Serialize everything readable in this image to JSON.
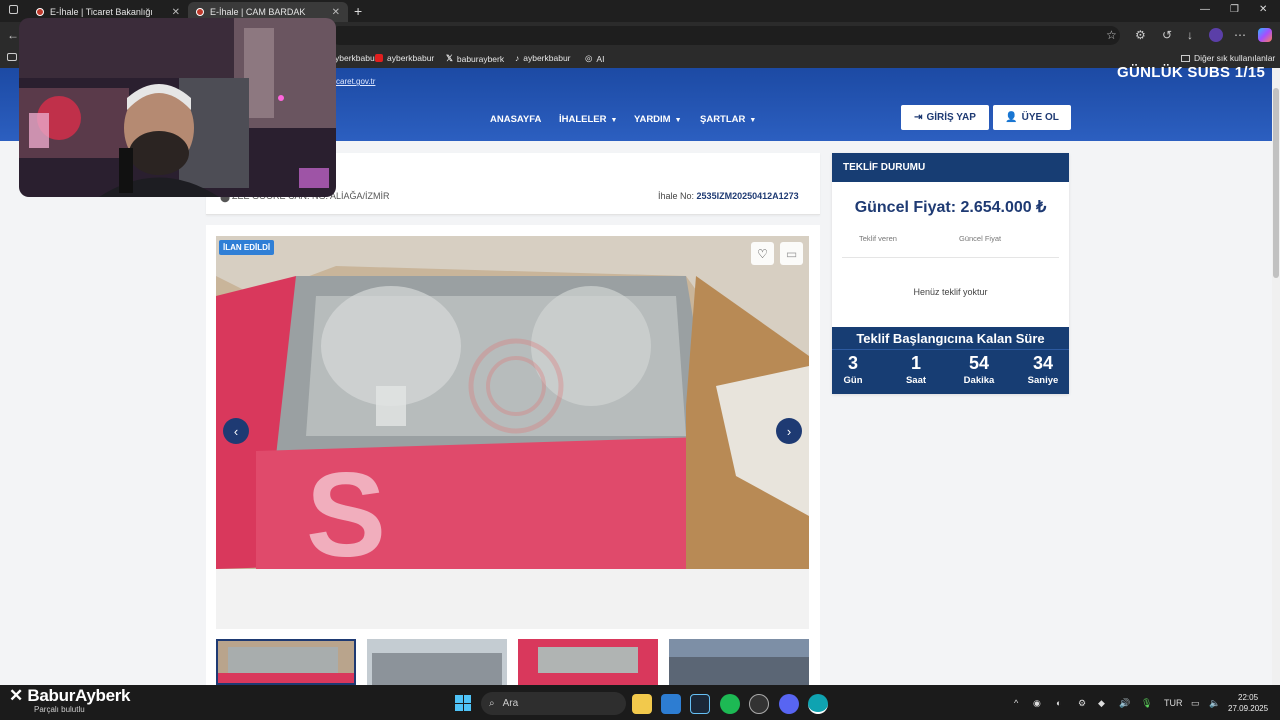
{
  "browser": {
    "tabs": [
      {
        "title": "E-İhale | Ticaret Bakanlığı"
      },
      {
        "title": "E-İhale | CAM BARDAK"
      }
    ],
    "new_tab": "+",
    "bookmarks": [
      {
        "label": "yberkbabur"
      },
      {
        "label": "ayberkbabur"
      },
      {
        "label": "baburayberk"
      },
      {
        "label": "ayberkbabur"
      },
      {
        "label": "AI"
      }
    ],
    "other_bookmarks": "Diğer sık kullanılanlar"
  },
  "overlay": {
    "subs": "GÜNLÜK SUBS 1/15",
    "brand_name": "BaburAyberk",
    "brand_sub": "Parçalı bulutlu"
  },
  "site": {
    "top_url": "caret.gov.tr",
    "nav": [
      {
        "label": "ANASAYFA"
      },
      {
        "label": "İHALELER"
      },
      {
        "label": "YARDIM"
      },
      {
        "label": "ŞARTLAR"
      }
    ],
    "login": "GİRİŞ YAP",
    "register": "ÜYE OL"
  },
  "listing": {
    "location": "ZEE GOORE CAN. NG. ALİAĞA/İZMİR",
    "ihale_label": "İhale No:",
    "ihale_no": "2535IZM20250412A1273",
    "badge": "İLAN EDİLDİ"
  },
  "bid": {
    "header": "TEKLİF DURUMU",
    "price": "Güncel Fiyat: 2.654.000 ₺",
    "col_bidder": "Teklif veren",
    "col_price": "Güncel Fiyat",
    "empty": "Henüz teklif yoktur",
    "countdown_title": "Teklif Başlangıcına Kalan Süre",
    "countdown": [
      {
        "value": "3",
        "label": "Gün"
      },
      {
        "value": "1",
        "label": "Saat"
      },
      {
        "value": "54",
        "label": "Dakika"
      },
      {
        "value": "34",
        "label": "Saniye"
      }
    ]
  },
  "taskbar": {
    "search": "Ara",
    "lang": "TUR",
    "time": "22:05",
    "date": "27.09.2025"
  },
  "colors": {
    "header": "#1c4aa4",
    "panel": "#173d73",
    "badge": "#2f7fd6"
  }
}
